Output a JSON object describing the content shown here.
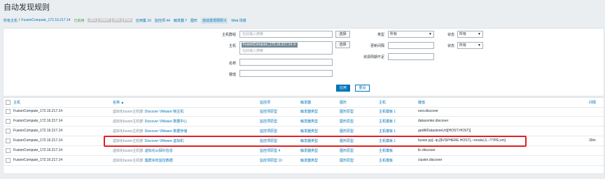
{
  "page_title": "自动发现规则",
  "breadcrumb": {
    "all_hosts": "所有主机",
    "sep": "/",
    "host": "FusionCompute_172.16.217.14",
    "status": "已启用",
    "badges": [
      "ZBX",
      "SNMP",
      "JMX",
      "IPMI"
    ],
    "apps": "应用集 10",
    "items": "监控项 44",
    "triggers": "触发器 7",
    "graphs": "图形",
    "discovery": "自动发现规则 6",
    "web": "Web 场景"
  },
  "filter": {
    "host_group_label": "主机群组",
    "host_group_placeholder": "在此输入搜索",
    "select_label": "选择",
    "host_label": "主机",
    "host_tag": "FusionCompute_172.16.217.14",
    "host_placeholder": "在此输入搜索",
    "name_label": "名称",
    "key_label": "键值",
    "type_label": "类型",
    "type_value": "所有",
    "update_interval_label": "更新间隔",
    "keep_lost_label": "资源周期不足",
    "state_label": "状态",
    "state_value": "所有",
    "status_label": "状态",
    "status_value": "所有",
    "apply": "应用",
    "reset": "重设"
  },
  "table": {
    "headers": [
      "主机",
      "名称 ▲",
      "监控项",
      "触发器",
      "图形",
      "主机",
      "键值",
      "间隔"
    ],
    "rows": [
      {
        "host": "FusionCompute_172.16.217.14",
        "name_prefix": "虚拟化fusion主机部:",
        "name": "Discover VMware 物主机",
        "items": "监控项原型",
        "triggers": "触发器类型",
        "graphs": "图形原型",
        "hosts": "主机模板 1",
        "key": "esxi.discover",
        "interval": ""
      },
      {
        "host": "FusionCompute_172.16.217.14",
        "name_prefix": "虚拟化fusion主机部:",
        "name": "Discover VMware 数据中心",
        "items": "监控项原型",
        "triggers": "触发器类型",
        "graphs": "图形原型",
        "hosts": "主机模板 1",
        "key": "datacenter.discover",
        "interval": ""
      },
      {
        "host": "FusionCompute_172.16.217.14",
        "name_prefix": "虚拟化fusion主机部:",
        "name": "Discover VMware 数据存储",
        "items": "监控项原型",
        "triggers": "触发器类型",
        "graphs": "图形原型",
        "hosts": "主机模板 1",
        "key": "getAllDatastoreUri[{HOST.HOST}]",
        "interval": ""
      },
      {
        "host": "FusionCompute_172.16.217.14",
        "name_prefix": "虚拟化fusion主机部:",
        "name": "Discover VMware 虚拟机",
        "items": "监控项原型",
        "triggers": "触发器类型",
        "graphs": "图形原型",
        "hosts": "主机模板 1",
        "key": "fusion.py[--ip,{$VSPHERE.HOST},--modul,3,--TYPE,vm]",
        "interval": "30m"
      },
      {
        "host": "FusionCompute_172.16.217.14",
        "name_prefix": "虚拟化fusion主机部:",
        "name": "虚拟化vc探针信息",
        "items": "监控项原型 4",
        "triggers": "触发器类型",
        "graphs": "图形原型",
        "hosts": "主机模板",
        "key": "lic.discover",
        "interval": ""
      },
      {
        "host": "FusionCompute_172.16.217.14",
        "name_prefix": "虚拟化fusion主机部:",
        "name": "集群实时监控数据",
        "items": "监控项原型 10",
        "triggers": "触发器类型",
        "graphs": "图形原型",
        "hosts": "主机模板",
        "key": "cluster.discover",
        "interval": ""
      }
    ]
  }
}
